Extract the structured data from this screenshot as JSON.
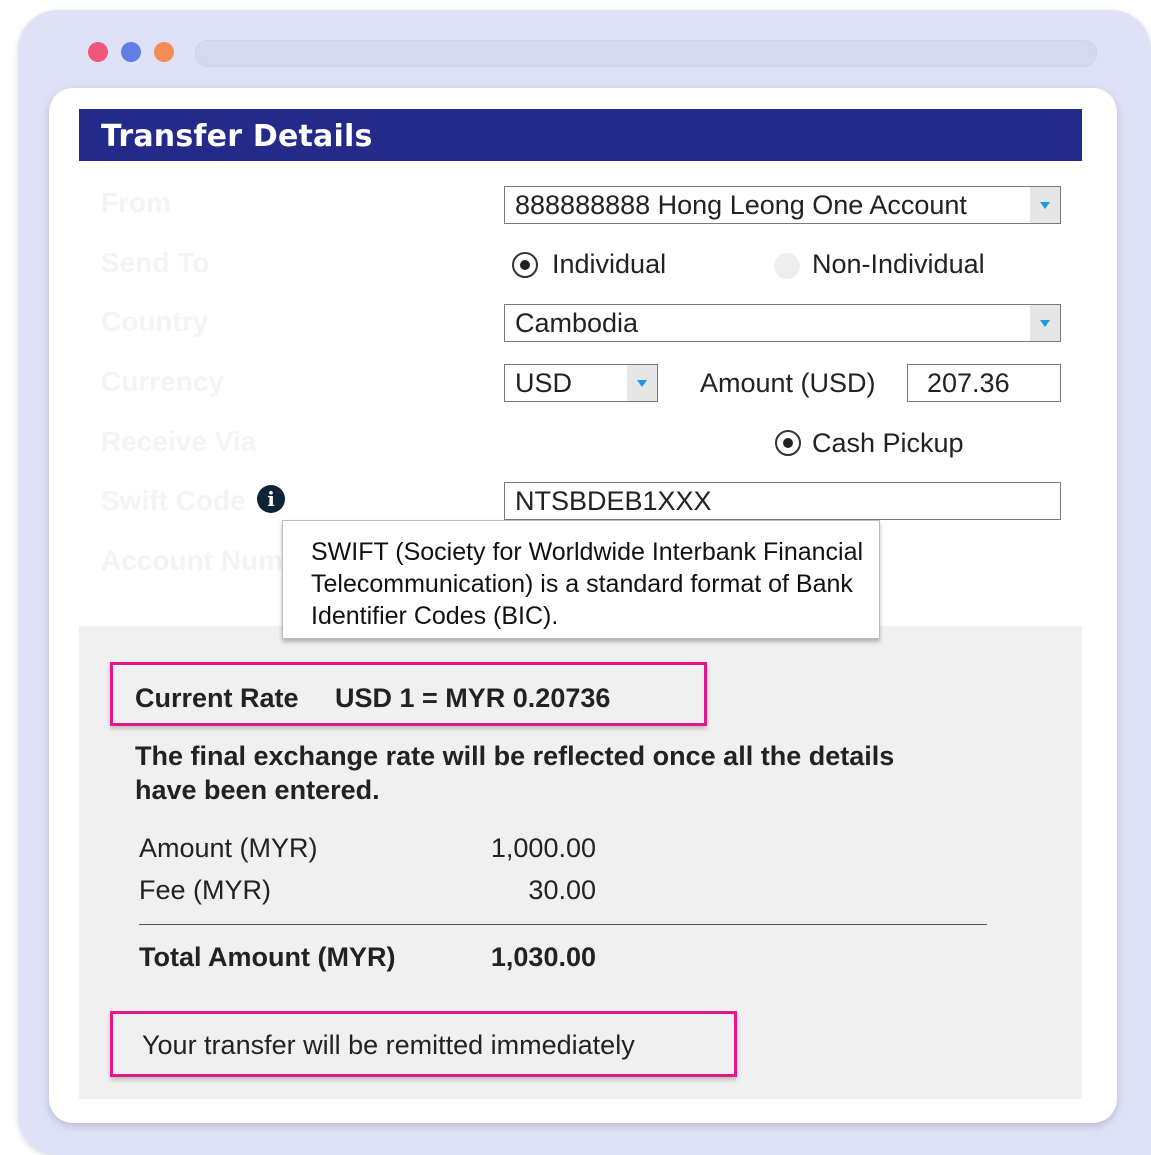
{
  "header": {
    "title": "Transfer Details"
  },
  "form": {
    "labels": {
      "from": "From",
      "send_to": "Send To",
      "country": "Country",
      "currency": "Currency",
      "receive_via": "Receive Via",
      "swift_code": "Swift Code",
      "account_number": "Account Num"
    },
    "from_account": "888888888 Hong Leong One Account",
    "send_to_options": [
      "Individual",
      "Non-Individual"
    ],
    "send_to_selected": "Individual",
    "country": "Cambodia",
    "currency": "USD",
    "amount_label": "Amount (USD)",
    "amount_value": "207.36",
    "receive_via": "Cash Pickup",
    "swift_code": "NTSBDEB1XXX"
  },
  "tooltip": {
    "text": "SWIFT (Society for Worldwide Interbank Financial Telecommunication) is a standard format of Bank Identifier Codes (BIC)."
  },
  "summary": {
    "rate_label": "Current Rate",
    "rate_value": "USD 1 = MYR 0.20736",
    "note": "The final exchange rate will be reflected once all the details have been entered.",
    "amount_label": "Amount (MYR)",
    "amount_value": "1,000.00",
    "fee_label": "Fee (MYR)",
    "fee_value": "30.00",
    "total_label": "Total Amount (MYR)",
    "total_value": "1,030.00",
    "remit_message": "Your transfer will be remitted immediately"
  },
  "colors": {
    "header_bg": "#232a8a",
    "highlight": "#e3178c",
    "caret": "#1e9be0"
  }
}
